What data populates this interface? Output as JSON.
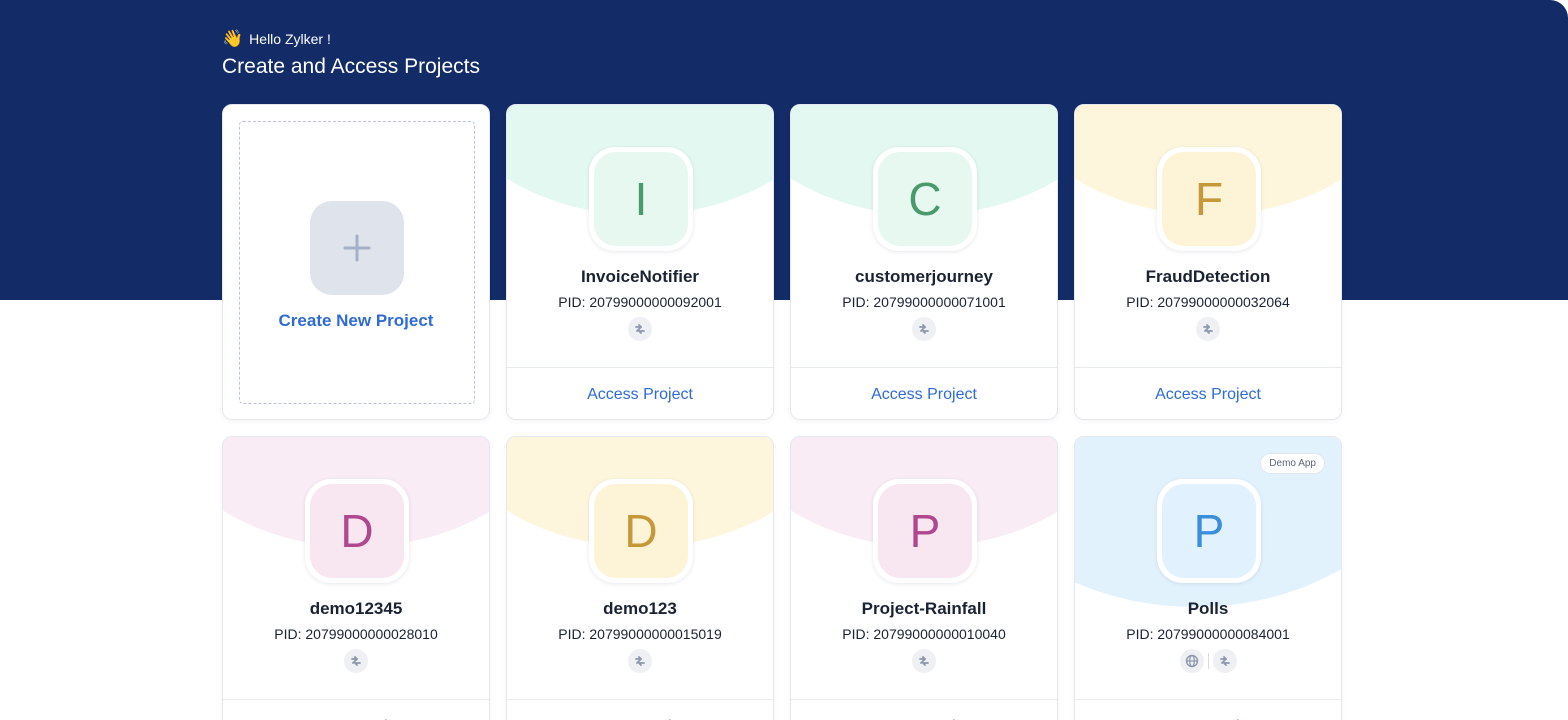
{
  "header": {
    "wave_emoji": "👋",
    "greeting": "Hello Zylker !",
    "title": "Create and Access Projects"
  },
  "create_card": {
    "label": "Create New Project",
    "icon": "plus-icon"
  },
  "projects": [
    {
      "initial": "I",
      "name": "InvoiceNotifier",
      "pid": "PID: 20799000000092001",
      "action": "Access Project",
      "theme": "green",
      "icons": [
        "integration-icon"
      ]
    },
    {
      "initial": "C",
      "name": "customerjourney",
      "pid": "PID: 20799000000071001",
      "action": "Access Project",
      "theme": "green",
      "icons": [
        "integration-icon"
      ]
    },
    {
      "initial": "F",
      "name": "FraudDetection",
      "pid": "PID: 20799000000032064",
      "action": "Access Project",
      "theme": "yellow",
      "icons": [
        "integration-icon"
      ]
    },
    {
      "initial": "D",
      "name": "demo12345",
      "pid": "PID: 20799000000028010",
      "action": "Access Project",
      "theme": "pink",
      "icons": [
        "integration-icon"
      ]
    },
    {
      "initial": "D",
      "name": "demo123",
      "pid": "PID: 20799000000015019",
      "action": "Access Project",
      "theme": "yellow",
      "icons": [
        "integration-icon"
      ]
    },
    {
      "initial": "P",
      "name": "Project-Rainfall",
      "pid": "PID: 20799000000010040",
      "action": "Access Project",
      "theme": "pink",
      "icons": [
        "integration-icon"
      ]
    },
    {
      "initial": "P",
      "name": "Polls",
      "pid": "PID: 20799000000084001",
      "action": "Access Project",
      "theme": "blue",
      "tag": "Demo App",
      "icons": [
        "globe-icon",
        "integration-icon"
      ]
    }
  ],
  "themes": {
    "green": {
      "arc": "#e3f8f1",
      "tile": "#e6f8f0",
      "letter": "#4a9a6e"
    },
    "yellow": {
      "arc": "#fdf6dc",
      "tile": "#fdf3d6",
      "letter": "#c6983a"
    },
    "pink": {
      "arc": "#f9ecf5",
      "tile": "#f8e6f1",
      "letter": "#b0488f"
    },
    "blue": {
      "arc": "#e2f2fd",
      "tile": "#e1f1fd",
      "letter": "#3b8edb"
    }
  },
  "colors": {
    "hero_background": "#132b66",
    "link": "#2e6bd6"
  }
}
